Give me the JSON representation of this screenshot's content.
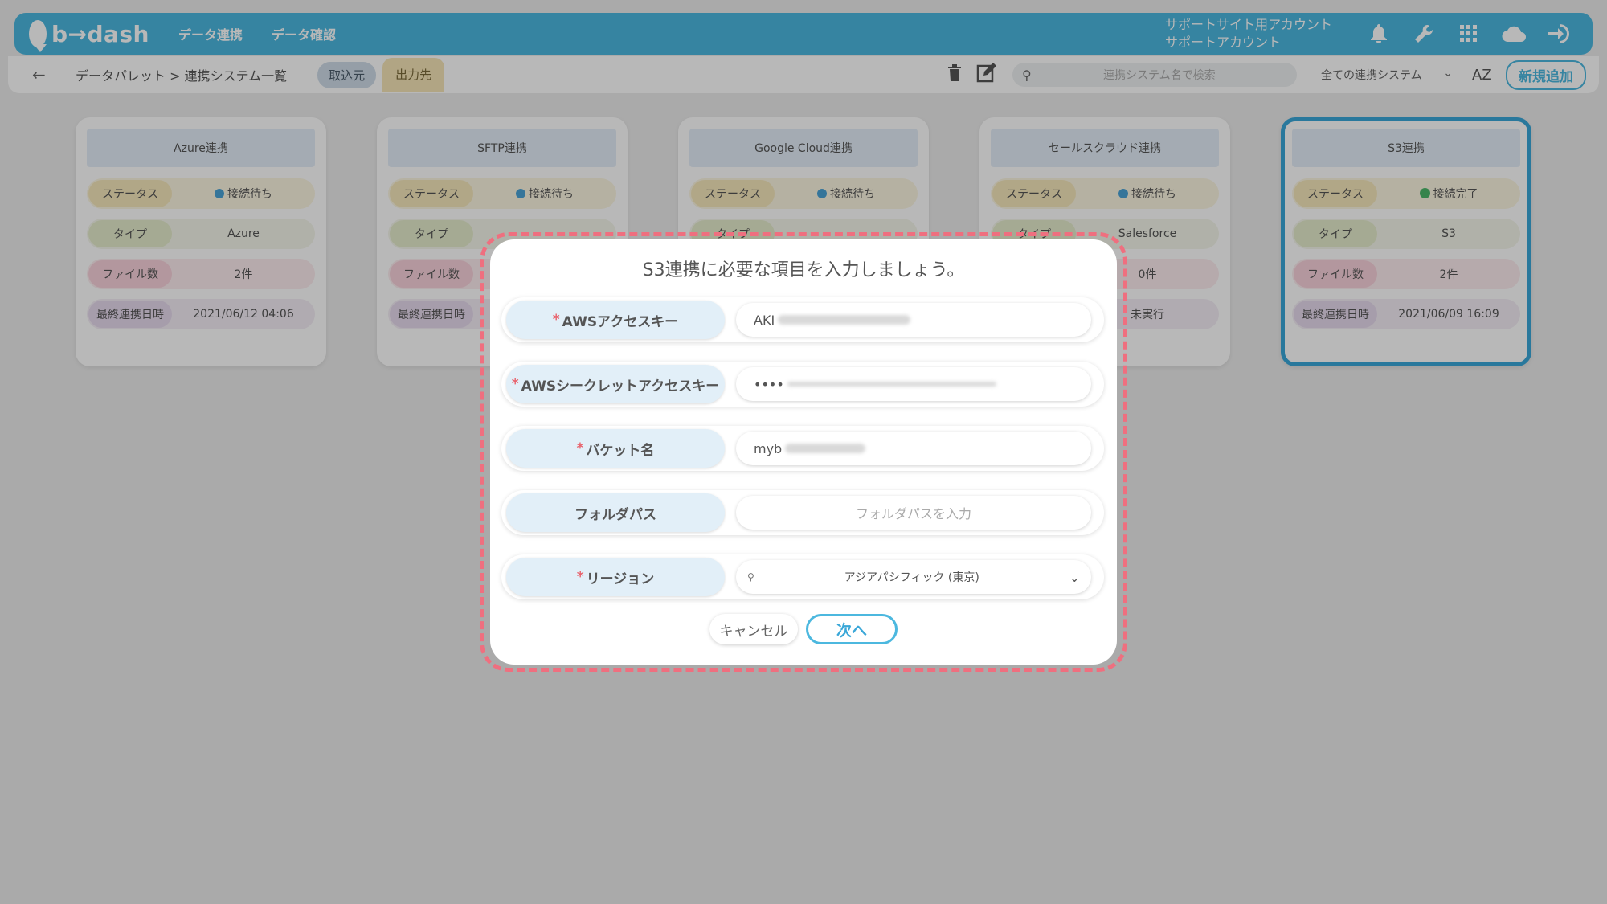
{
  "header": {
    "logo_text": "b→dash",
    "nav": [
      "データ連携",
      "データ確認"
    ],
    "account_line1": "サポートサイト用アカウント",
    "account_line2": "サポートアカウント",
    "icons": [
      "bell-icon",
      "wrench-icon",
      "grid-icon",
      "cloud-icon",
      "logout-icon"
    ]
  },
  "subheader": {
    "back": "←",
    "breadcrumb": "データパレット  >  連携システム一覧",
    "tab_import": "取込元",
    "tab_export": "出力先",
    "search_placeholder": "連携システム名で検索",
    "filter_value": "全ての連携システム",
    "sort_label": "AZ",
    "add_button": "新規追加"
  },
  "card_labels": {
    "status": "ステータス",
    "type": "タイプ",
    "files": "ファイル数",
    "last_sync": "最終連携日時"
  },
  "cards": [
    {
      "title": "Azure連携",
      "status": "接続待ち",
      "type": "Azure",
      "files": "2件",
      "last_sync": "2021/06/12 04:06"
    },
    {
      "title": "SFTP連携",
      "status": "接続待ち",
      "type": "",
      "files": "",
      "last_sync": ""
    },
    {
      "title": "Google Cloud連携",
      "status": "接続待ち",
      "type": "",
      "files": "",
      "last_sync": ""
    },
    {
      "title": "セールスクラウド連携",
      "status": "接続待ち",
      "type": "Salesforce",
      "files": "0件",
      "last_sync": "未実行"
    },
    {
      "title": "S3連携",
      "status": "接続完了",
      "type": "S3",
      "files": "2件",
      "last_sync": "2021/06/09 16:09"
    }
  ],
  "modal": {
    "title": "S3連携に必要な項目を入力しましょう。",
    "required_mark": "*",
    "fields": [
      {
        "label": "AWSアクセスキー",
        "value": "AKI"
      },
      {
        "label": "AWSシークレットアクセスキー",
        "value": "••••"
      },
      {
        "label": "バケット名",
        "value": "myb"
      },
      {
        "label": "フォルダパス",
        "placeholder": "フォルダパスを入力"
      },
      {
        "label": "リージョン",
        "value": "アジアパシフィック (東京)"
      }
    ],
    "cancel": "キャンセル",
    "next": "次へ"
  },
  "colors": {
    "accent": "#4cb8df",
    "dashed_frame": "#ef6f7f",
    "required": "#e8626c"
  }
}
